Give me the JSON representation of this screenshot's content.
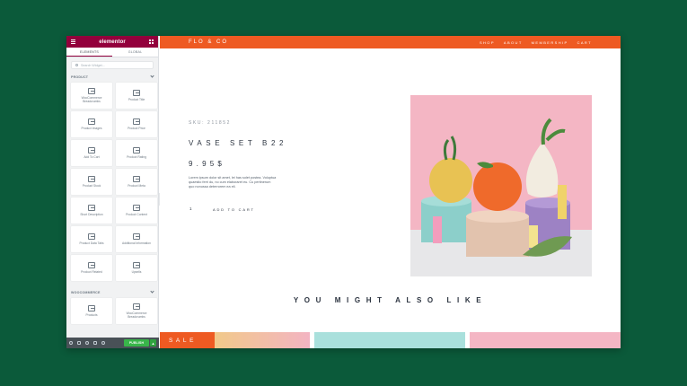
{
  "editor": {
    "logo": "elementor",
    "tabs": [
      {
        "label": "ELEMENTS",
        "active": true
      },
      {
        "label": "GLOBAL",
        "active": false
      }
    ],
    "search_placeholder": "Search Widget...",
    "section_product": "PRODUCT",
    "section_woocommerce": "WOOCOMMERCE",
    "product_widgets": [
      {
        "label": "WooCommerce Breadcrumbs",
        "icon": "breadcrumbs-icon"
      },
      {
        "label": "Product Title",
        "icon": "product-title-icon"
      },
      {
        "label": "Product Images",
        "icon": "product-images-icon"
      },
      {
        "label": "Product Price",
        "icon": "product-price-icon"
      },
      {
        "label": "Add To Cart",
        "icon": "add-to-cart-icon"
      },
      {
        "label": "Product Rating",
        "icon": "product-rating-icon"
      },
      {
        "label": "Product Stock",
        "icon": "product-stock-icon"
      },
      {
        "label": "Product Meta",
        "icon": "product-meta-icon"
      },
      {
        "label": "Short Description",
        "icon": "short-description-icon"
      },
      {
        "label": "Product Content",
        "icon": "product-content-icon"
      },
      {
        "label": "Product Data Tabs",
        "icon": "product-data-tabs-icon"
      },
      {
        "label": "Additional Information",
        "icon": "additional-information-icon"
      },
      {
        "label": "Product Related",
        "icon": "product-related-icon"
      },
      {
        "label": "Upsells",
        "icon": "upsells-icon"
      }
    ],
    "woocommerce_widgets": [
      {
        "label": "Products",
        "icon": "products-icon"
      },
      {
        "label": "WooCommerce Breadcrumbs",
        "icon": "breadcrumbs-icon"
      }
    ],
    "publish_label": "PUBLISH",
    "publish_more": "▲",
    "accent": "#93003c",
    "publish_color": "#39b54a"
  },
  "site": {
    "logo": "FLO & CO",
    "menu": [
      "SHOP",
      "ABOUT",
      "MEMBERSHIP",
      "CART"
    ],
    "nav_color": "#ee5a22",
    "product": {
      "sku": "SKU: 211852",
      "title": "VASE SET B22",
      "price": "9.95$",
      "description": "Lorem ipsum dolor sit amet, lei has solet postea. Voluptua quaestio ferri du, no cum elaboraret eu. Cu pertinerum quo nonussa deterrorem ea eli.",
      "quantity": "1",
      "add_to_cart": "ADD TO CART"
    },
    "related_heading": "YOU MIGHT ALSO LIKE",
    "sale_badge": "SALE"
  }
}
